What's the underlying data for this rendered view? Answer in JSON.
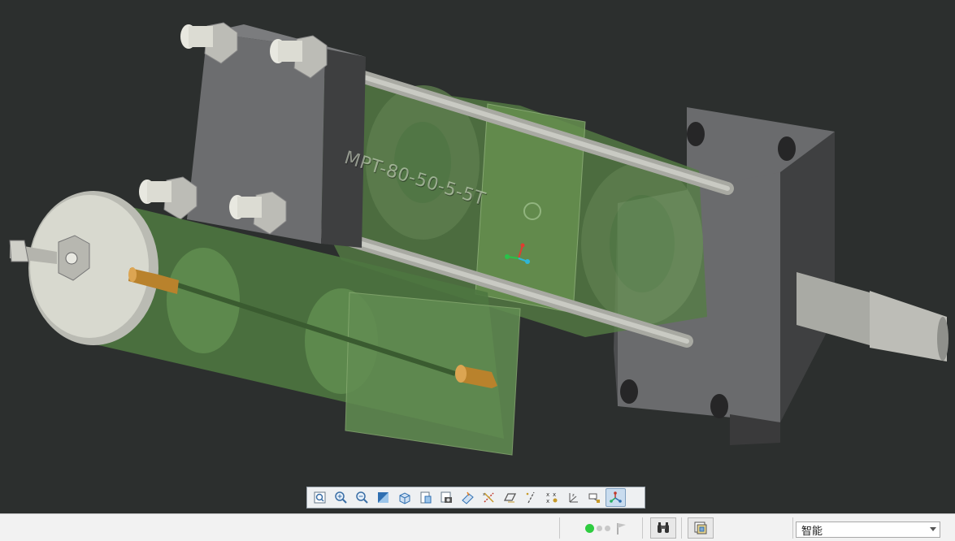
{
  "model": {
    "part_label": "MPT-80-50-5-5T"
  },
  "colors": {
    "viewport_bg": "#2c2f2e",
    "transparent_body": "#5e8a4d",
    "plate": "#57585a",
    "rod": "#b8b9b2",
    "brass": "#b9822c",
    "triad_x": "#e03c31",
    "triad_y": "#29c24a",
    "triad_z": "#2fb6d6"
  },
  "view_toolbar": {
    "buttons": [
      {
        "name": "refit-button",
        "icon": "refit-icon"
      },
      {
        "name": "zoom-in-button",
        "icon": "zoom-in-icon"
      },
      {
        "name": "zoom-out-button",
        "icon": "zoom-out-icon"
      },
      {
        "name": "repaint-button",
        "icon": "repaint-icon"
      },
      {
        "name": "display-style-button",
        "icon": "display-style-icon"
      },
      {
        "name": "saved-orientations-button",
        "icon": "saved-orientations-icon"
      },
      {
        "name": "view-manager-button",
        "icon": "view-manager-icon"
      },
      {
        "name": "perspective-button",
        "icon": "perspective-icon"
      },
      {
        "name": "datum-display-button",
        "icon": "datum-display-icon"
      },
      {
        "name": "plane-display-button",
        "icon": "plane-display-icon"
      },
      {
        "name": "axis-display-button",
        "icon": "axis-display-icon"
      },
      {
        "name": "point-display-button",
        "icon": "point-display-icon"
      },
      {
        "name": "csys-display-button",
        "icon": "csys-display-icon"
      },
      {
        "name": "annotation-display-button",
        "icon": "annotation-display-icon"
      },
      {
        "name": "spin-center-button",
        "icon": "spin-center-icon",
        "active": true
      }
    ]
  },
  "status_bar": {
    "regen_status": "green",
    "filter_value": "智能"
  }
}
